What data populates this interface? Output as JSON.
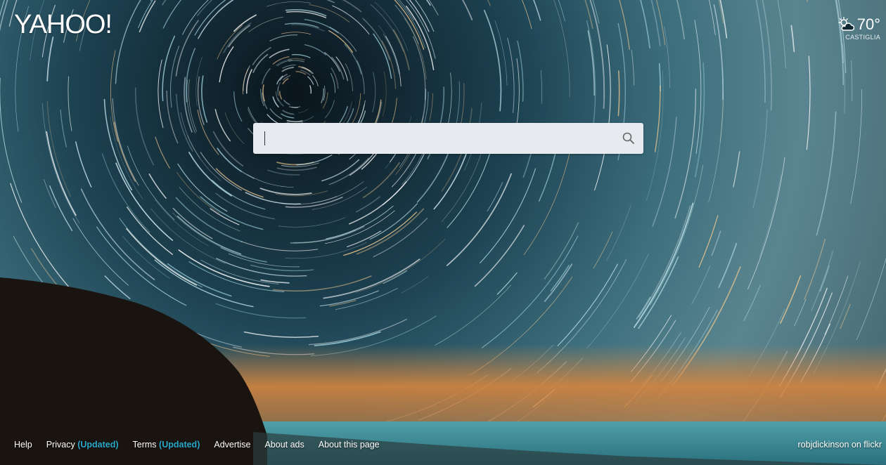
{
  "brand": {
    "logo_text": "YAHOO!"
  },
  "weather": {
    "temperature": "70°",
    "location": "CASTIGLIA",
    "icon": "partly-sunny-icon"
  },
  "search": {
    "placeholder": "",
    "value": "",
    "icon": "search-icon"
  },
  "footer": {
    "links": [
      {
        "label": "Help"
      },
      {
        "label": "Privacy",
        "tag": "(Updated)"
      },
      {
        "label": "Terms",
        "tag": "(Updated)"
      },
      {
        "label": "Advertise"
      },
      {
        "label": "About ads"
      },
      {
        "label": "About this page"
      }
    ],
    "photo_credit": "robjdickinson on flickr"
  },
  "colors": {
    "sky_top": "#0b1922",
    "sky_mid": "#2c5566",
    "horizon_glow": "#d4843e",
    "sea": "#2f7e8c",
    "cliff": "#1a1410",
    "search_bg": "#e7ebef",
    "updated_accent": "#2aa7c9"
  }
}
